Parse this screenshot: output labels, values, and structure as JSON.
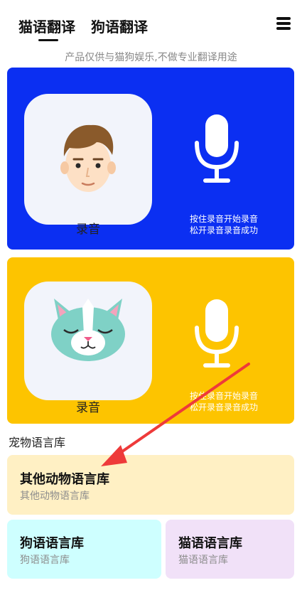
{
  "header": {
    "tabs": [
      {
        "label": "猫语翻译",
        "active": true
      },
      {
        "label": "狗语翻译",
        "active": false
      }
    ],
    "subtitle": "产品仅供与猫狗娱乐,不做专业翻译用途"
  },
  "human_panel": {
    "record_label": "录音",
    "hint_line1": "按住录音开始录音",
    "hint_line2": "松开录音录音成功",
    "background": "#0b2ff2"
  },
  "cat_panel": {
    "record_label": "录音",
    "hint_line1": "按住录音开始录音",
    "hint_line2": "松开录音录音成功",
    "background": "#fdc400"
  },
  "library": {
    "section_title": "宠物语言库",
    "items": [
      {
        "name": "其他动物语言库",
        "desc": "其他动物语言库",
        "color": "#fff0c4"
      },
      {
        "name": "狗语语言库",
        "desc": "狗语语言库",
        "color": "#ceffff"
      },
      {
        "name": "猫语语言库",
        "desc": "猫语语言库",
        "color": "#f1e1f8"
      }
    ]
  },
  "icons": [
    "menu-icon",
    "man-avatar-icon",
    "cat-avatar-icon",
    "microphone-icon"
  ],
  "annotation_color": "#ee3a3a"
}
